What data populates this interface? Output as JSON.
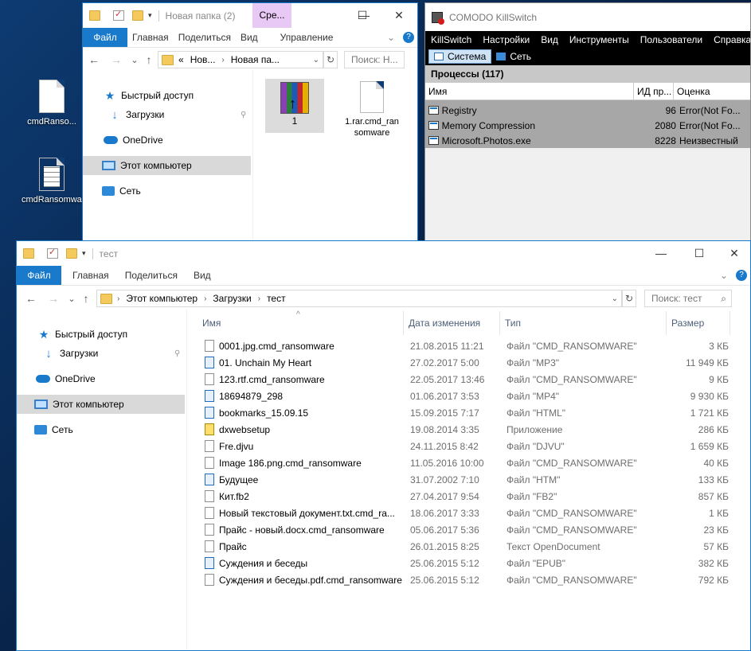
{
  "desktop": {
    "icons": [
      {
        "label": "cmdRanso..."
      },
      {
        "label": "cmdRansomware"
      }
    ]
  },
  "explorer_top": {
    "title": "Новая папка (2)",
    "context_tab": "Сре...",
    "ribbon": {
      "file": "Файл",
      "home": "Главная",
      "share": "Поделиться",
      "view": "Вид",
      "manage": "Управление"
    },
    "address": {
      "chevron": "«",
      "crumb1": "Нов...",
      "crumb2": "Новая па..."
    },
    "search_placeholder": "Поиск: Н...",
    "nav": [
      {
        "label": "Быстрый доступ"
      },
      {
        "label": "Загрузки"
      },
      {
        "label": "OneDrive"
      },
      {
        "label": "Этот компьютер"
      },
      {
        "label": "Сеть"
      }
    ],
    "items": [
      {
        "label": "1"
      },
      {
        "label": "1.rar.cmd_ransomware"
      }
    ]
  },
  "killswitch": {
    "title": "COMODO KillSwitch",
    "menu": [
      "KillSwitch",
      "Настройки",
      "Вид",
      "Инструменты",
      "Пользователи",
      "Справка"
    ],
    "tabs": [
      {
        "label": "Система"
      },
      {
        "label": "Сеть"
      }
    ],
    "header": "Процессы (117)",
    "columns": [
      "Имя",
      "ИД пр...",
      "Оценка"
    ],
    "rows": [
      {
        "name": "Registry",
        "pid": "96",
        "rating": "Error(Not Fo..."
      },
      {
        "name": "Memory Compression",
        "pid": "2080",
        "rating": "Error(Not Fo..."
      },
      {
        "name": "Microsoft.Photos.exe",
        "pid": "8228",
        "rating": "Неизвестный"
      }
    ]
  },
  "explorer_main": {
    "title": "тест",
    "ribbon": {
      "file": "Файл",
      "home": "Главная",
      "share": "Поделиться",
      "view": "Вид"
    },
    "address": {
      "crumb1": "Этот компьютер",
      "crumb2": "Загрузки",
      "crumb3": "тест"
    },
    "search_placeholder": "Поиск: тест",
    "nav": [
      {
        "label": "Быстрый доступ"
      },
      {
        "label": "Загрузки"
      },
      {
        "label": "OneDrive"
      },
      {
        "label": "Этот компьютер"
      },
      {
        "label": "Сеть"
      }
    ],
    "columns": {
      "name": "Имя",
      "date": "Дата изменения",
      "type": "Тип",
      "size": "Размер"
    },
    "files": [
      {
        "name": "0001.jpg.cmd_ransomware",
        "date": "21.08.2015 11:21",
        "type": "Файл \"CMD_RANSOMWARE\"",
        "size": "3 КБ",
        "icon": "file-icon"
      },
      {
        "name": "01. Unchain My Heart",
        "date": "27.02.2017 5:00",
        "type": "Файл \"MP3\"",
        "size": "11 949 КБ",
        "icon": "media-icon"
      },
      {
        "name": "123.rtf.cmd_ransomware",
        "date": "22.05.2017 13:46",
        "type": "Файл \"CMD_RANSOMWARE\"",
        "size": "9 КБ",
        "icon": "file-icon"
      },
      {
        "name": "18694879_298",
        "date": "01.06.2017 3:53",
        "type": "Файл \"MP4\"",
        "size": "9 930 КБ",
        "icon": "video-icon"
      },
      {
        "name": "bookmarks_15.09.15",
        "date": "15.09.2015 7:17",
        "type": "Файл \"HTML\"",
        "size": "1 721 КБ",
        "icon": "browser-icon"
      },
      {
        "name": "dxwebsetup",
        "date": "19.08.2014 3:35",
        "type": "Приложение",
        "size": "286 КБ",
        "icon": "app-icon"
      },
      {
        "name": "Fre.djvu",
        "date": "24.11.2015 8:42",
        "type": "Файл \"DJVU\"",
        "size": "1 659 КБ",
        "icon": "file-icon"
      },
      {
        "name": "Image 186.png.cmd_ransomware",
        "date": "11.05.2016 10:00",
        "type": "Файл \"CMD_RANSOMWARE\"",
        "size": "40 КБ",
        "icon": "file-icon"
      },
      {
        "name": "Будущее",
        "date": "31.07.2002 7:10",
        "type": "Файл \"HTM\"",
        "size": "133 КБ",
        "icon": "browser-icon"
      },
      {
        "name": "Кит.fb2",
        "date": "27.04.2017 9:54",
        "type": "Файл \"FB2\"",
        "size": "857 КБ",
        "icon": "file-icon"
      },
      {
        "name": "Новый текстовый документ.txt.cmd_ra...",
        "date": "18.06.2017 3:33",
        "type": "Файл \"CMD_RANSOMWARE\"",
        "size": "1 КБ",
        "icon": "file-icon"
      },
      {
        "name": "Прайс - новый.docx.cmd_ransomware",
        "date": "05.06.2017 5:36",
        "type": "Файл \"CMD_RANSOMWARE\"",
        "size": "23 КБ",
        "icon": "file-icon"
      },
      {
        "name": "Прайс",
        "date": "26.01.2015 8:25",
        "type": "Текст OpenDocument",
        "size": "57 КБ",
        "icon": "document-icon"
      },
      {
        "name": "Суждения и беседы",
        "date": "25.06.2015 5:12",
        "type": "Файл \"EPUB\"",
        "size": "382 КБ",
        "icon": "ebook-icon"
      },
      {
        "name": "Суждения и беседы.pdf.cmd_ransomware",
        "date": "25.06.2015 5:12",
        "type": "Файл \"CMD_RANSOMWARE\"",
        "size": "792 КБ",
        "icon": "file-icon"
      }
    ]
  }
}
